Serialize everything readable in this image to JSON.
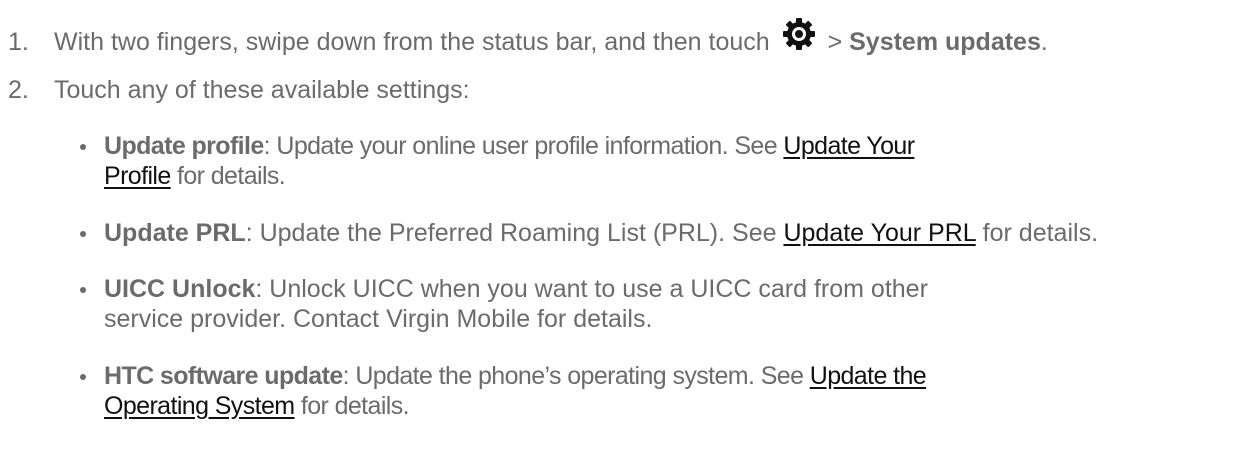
{
  "steps": [
    {
      "number": "1.",
      "text_before": "With two fingers, swipe down from the status bar, and then touch",
      "icon": "gear-icon",
      "separator": ">",
      "bold": "System updates",
      "text_after": "."
    },
    {
      "number": "2.",
      "text": "Touch any of these available settings:"
    }
  ],
  "settings": [
    {
      "name": "Update profile",
      "desc_before": ": Update your online user profile information. See ",
      "link": "Update Your Profile",
      "desc_after": " for details."
    },
    {
      "name": "Update PRL",
      "desc_before": ": Update the Preferred Roaming List (PRL). See ",
      "link": "Update Your PRL",
      "desc_after": " for details."
    },
    {
      "name": "UICC Unlock",
      "desc_before": ": Unlock UICC when you want to use a UICC card from other service provider. Contact Virgin Mobile for details.",
      "link": "",
      "desc_after": ""
    },
    {
      "name": "HTC software update",
      "desc_before": ": Update the phone’s operating system. See ",
      "link": "Update the Operating System",
      "desc_after": " for details."
    }
  ]
}
